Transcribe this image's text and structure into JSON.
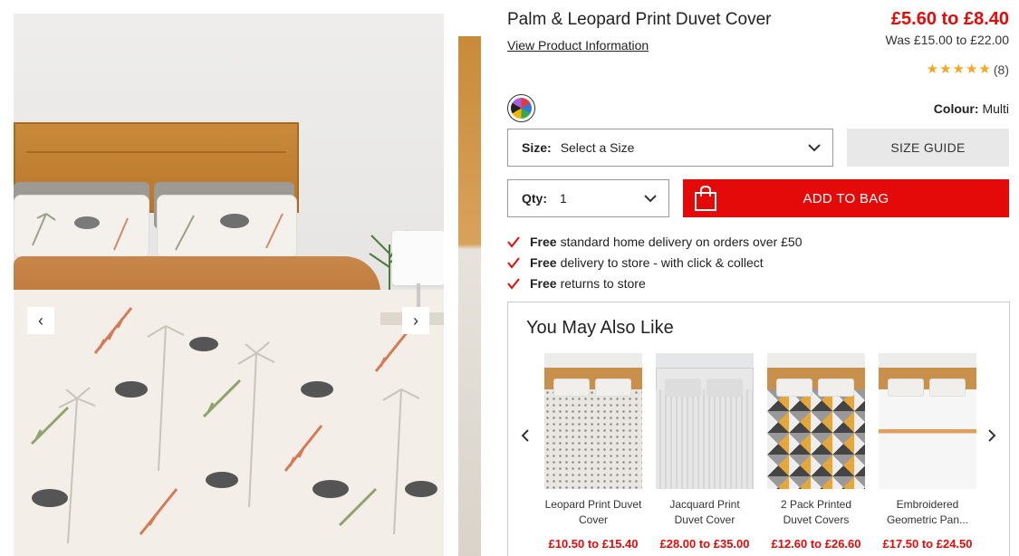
{
  "product": {
    "title": "Palm & Leopard Print Duvet Cover",
    "view_info": "View Product Information",
    "price": "£5.60 to £8.40",
    "was_price": "Was £15.00 to £22.00",
    "rating": {
      "stars": 5,
      "count": "(8)"
    },
    "colour_label": "Colour:",
    "colour_value": "Multi"
  },
  "gallery": {
    "prev_icon": "chevron-left-icon",
    "next_icon": "chevron-right-icon",
    "prev_glyph": "‹",
    "next_glyph": "›"
  },
  "size": {
    "label": "Size:",
    "value": "Select a Size"
  },
  "size_guide": "SIZE GUIDE",
  "qty": {
    "label": "Qty:",
    "value": "1"
  },
  "add_to_bag": "ADD TO BAG",
  "delivery": [
    {
      "bold": "Free",
      "text": "standard home delivery on orders over £50"
    },
    {
      "bold": "Free",
      "text": "delivery to store - with click & collect"
    },
    {
      "bold": "Free",
      "text": "returns to store"
    }
  ],
  "recommendations": {
    "title": "You May Also Like",
    "items": [
      {
        "name": "Leopard Print Duvet Cover",
        "price": "£10.50 to £15.40"
      },
      {
        "name": "Jacquard Print Duvet Cover",
        "price": "£28.00 to £35.00"
      },
      {
        "name": "2 Pack Printed Duvet Covers",
        "price": "£12.60 to £26.60"
      },
      {
        "name": "Embroidered Geometric Pan...",
        "price": "£17.50 to £24.50"
      }
    ]
  },
  "colors": {
    "accent_red": "#e40a0a",
    "star": "#f5a623"
  }
}
